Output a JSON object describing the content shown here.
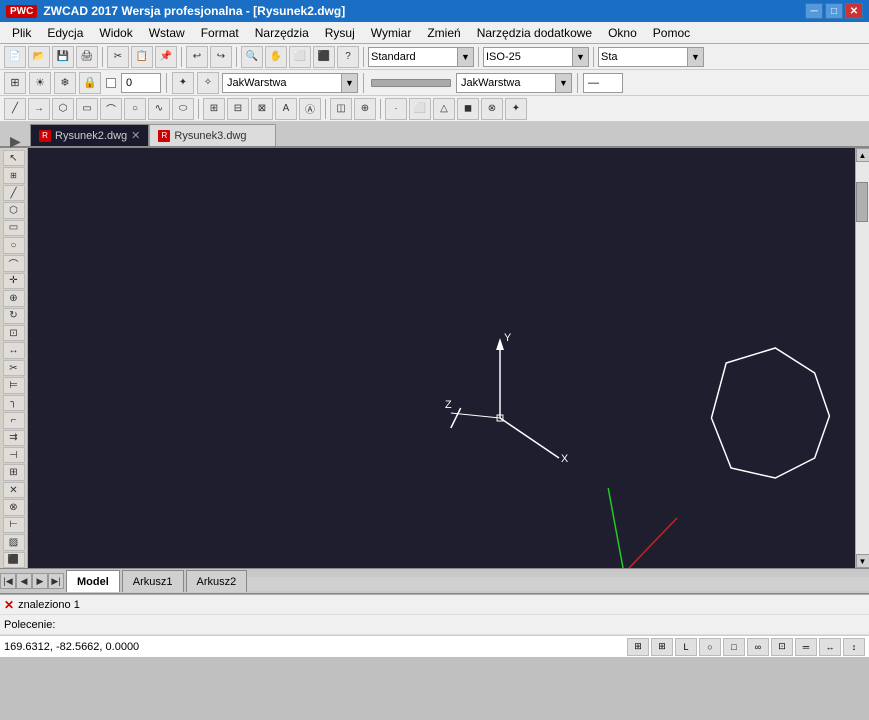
{
  "titlebar": {
    "logo": "PWC",
    "title": "ZWCAD 2017 Wersja profesjonalna - [Rysunek2.dwg]",
    "minimize": "─",
    "maximize": "□",
    "close": "✕"
  },
  "menubar": {
    "items": [
      "Plik",
      "Edycja",
      "Widok",
      "Wstaw",
      "Format",
      "Narzędzia",
      "Rysuj",
      "Wymiar",
      "Zmień",
      "Narzędzia dodatkowe",
      "Okno",
      "Pomoc"
    ]
  },
  "toolbar1": {
    "buttons": [
      "📄",
      "📂",
      "💾",
      "🖨",
      "✂",
      "📋",
      "📌",
      "↩",
      "↪",
      "🔍",
      "?",
      "⬜"
    ],
    "combos": [
      "Standard",
      "ISO-25",
      "Sta"
    ]
  },
  "toolbar2": {
    "layer_icon": "⚙",
    "layer_value": "0",
    "freeze_icon": "☀",
    "lock_icon": "🔓",
    "color": "#000000",
    "layer_name": "JakWarstwa",
    "linetype": "JakWarstwa"
  },
  "toolbar3": {
    "buttons": [
      "◼",
      "○",
      "△",
      "◯",
      "▭",
      "⊞",
      "⊕",
      "⊙",
      "╱",
      "◇",
      "⬡",
      "▷",
      "◁",
      "↕",
      "⊿",
      "⬜",
      "✦"
    ]
  },
  "tabs": [
    {
      "id": "rysunek2",
      "label": "Rysunek2.dwg",
      "active": true,
      "closable": true
    },
    {
      "id": "rysunek3",
      "label": "Rysunek3.dwg",
      "active": false,
      "closable": false
    }
  ],
  "canvas": {
    "background": "#1e1e2e"
  },
  "bottom_tabs": {
    "model": "Model",
    "sheets": [
      "Arkusz1",
      "Arkusz2"
    ]
  },
  "command_area": {
    "line1": "znaleziono 1",
    "line2": "Polecenie:",
    "coordinates": "169.6312, -82.5662, 0.0000",
    "x_icon": "✕"
  },
  "status_buttons": [
    "⊞",
    "⊞",
    "╱",
    "○",
    "○",
    "⬡",
    "⬡",
    "═",
    "↔",
    "↕"
  ]
}
